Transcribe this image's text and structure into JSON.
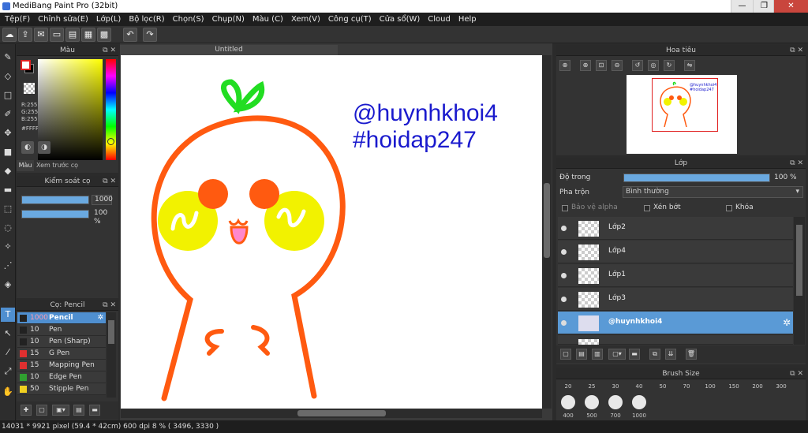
{
  "window": {
    "title": "MediBang Paint Pro (32bit)"
  },
  "menu": [
    "Tệp(F)",
    "Chỉnh sửa(E)",
    "Lớp(L)",
    "Bộ lọc(R)",
    "Chọn(S)",
    "Chụp(N)",
    "Màu (C)",
    "Xem(V)",
    "Công cụ(T)",
    "Cửa sổ(W)",
    "Cloud",
    "Help"
  ],
  "document": {
    "tab_title": "Untitled"
  },
  "color_panel": {
    "title": "Màu",
    "r": "R:255",
    "g": "G:255",
    "b": "B:255",
    "hex": "#FFFFFF",
    "tabs": [
      "Màu",
      "Xem trước cọ"
    ],
    "primary_color": "#ffffff",
    "secondary_color": "#000000"
  },
  "brush_control": {
    "title": "Kiểm soát cọ",
    "size_value": "1000",
    "opacity_value": "100 %"
  },
  "brush_list": {
    "title": "Cọ: Pencil",
    "items": [
      {
        "size": "1000",
        "name": "Pencil",
        "color": "#222222"
      },
      {
        "size": "10",
        "name": "Pen",
        "color": "#222222"
      },
      {
        "size": "10",
        "name": "Pen (Sharp)",
        "color": "#222222"
      },
      {
        "size": "15",
        "name": "G Pen",
        "color": "#e03030"
      },
      {
        "size": "15",
        "name": "Mapping Pen",
        "color": "#e03030"
      },
      {
        "size": "10",
        "name": "Edge Pen",
        "color": "#30a030"
      },
      {
        "size": "50",
        "name": "Stipple Pen",
        "color": "#f0d020"
      }
    ]
  },
  "canvas_text": {
    "line1": "@huynhkhoi4",
    "line2": "#hoidap247"
  },
  "navigator": {
    "title": "Hoa tiêu",
    "mini_line1": "@huynhkhoi4",
    "mini_line2": "#hoidap247"
  },
  "layer_panel": {
    "title": "Lớp",
    "opacity_label": "Độ trong",
    "opacity_value": "100 %",
    "blend_label": "Pha trộn",
    "blend_value": "Bình thường",
    "protect_alpha": "Bảo vệ alpha",
    "clipping": "Xén bớt",
    "lock": "Khóa",
    "layers": [
      {
        "name": "Lớp2",
        "selected": false
      },
      {
        "name": "Lớp4",
        "selected": false
      },
      {
        "name": "Lớp1",
        "selected": false
      },
      {
        "name": "Lớp3",
        "selected": false
      },
      {
        "name": "@huynhkhoi4",
        "selected": true
      }
    ]
  },
  "brush_size_panel": {
    "title": "Brush Size",
    "sizes_row1": [
      "20",
      "25",
      "30",
      "40",
      "50",
      "70",
      "100",
      "150",
      "200",
      "300"
    ],
    "sizes_row2": [
      "400",
      "500",
      "700",
      "1000"
    ]
  },
  "status": {
    "text": "14031 * 9921 pixel   (59.4 * 42cm)   600 dpi   8 %   ( 3496, 3330 )"
  }
}
